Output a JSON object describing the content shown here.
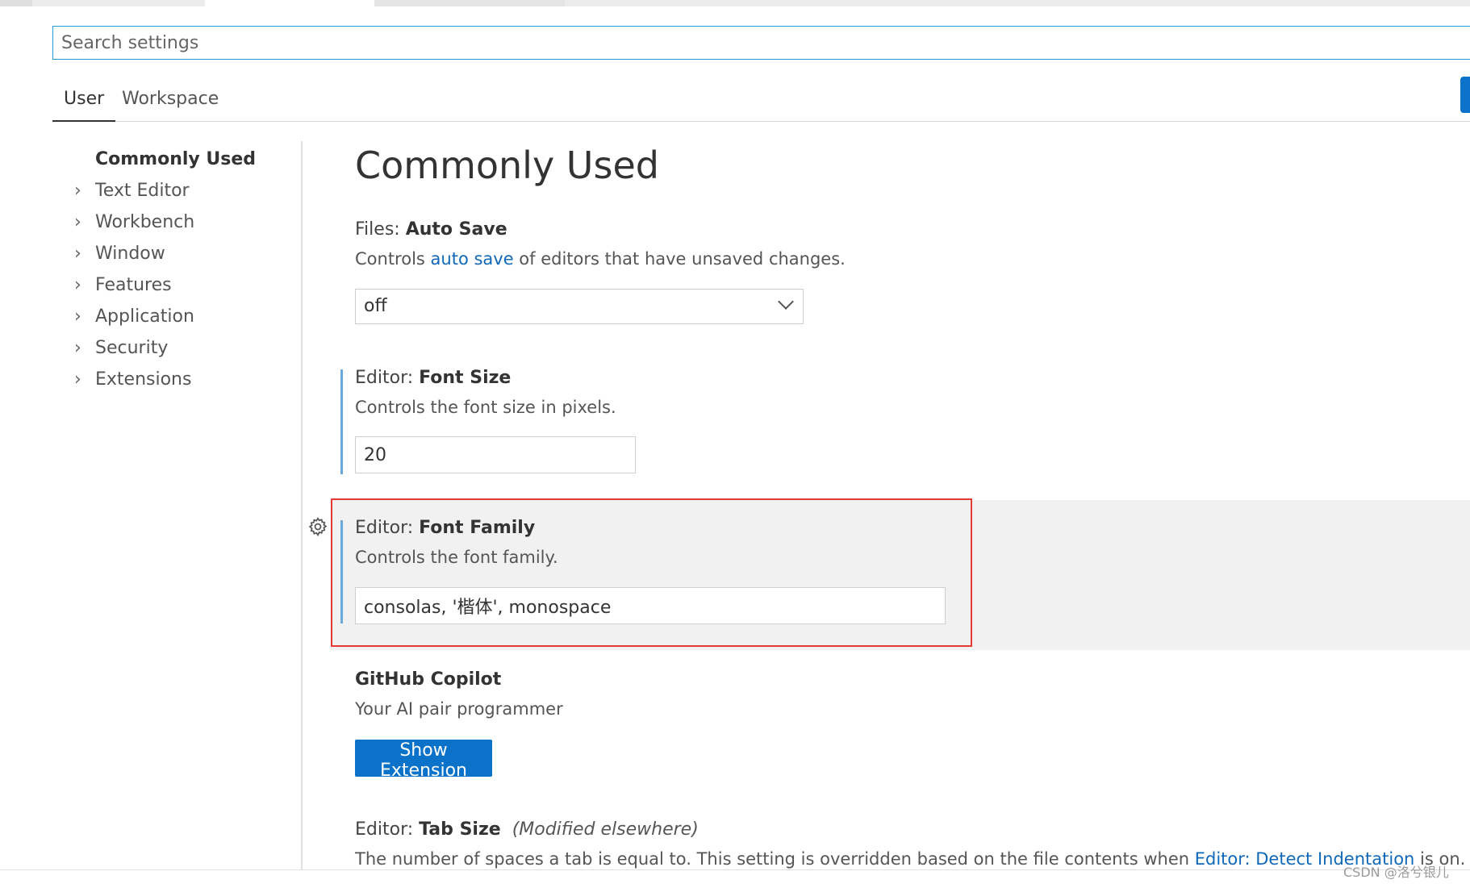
{
  "search": {
    "placeholder": "Search settings"
  },
  "tabs": [
    {
      "label": "User",
      "active": true
    },
    {
      "label": "Workspace",
      "active": false
    }
  ],
  "toc": {
    "items": [
      {
        "label": "Commonly Used",
        "bold": true,
        "chevron": false
      },
      {
        "label": "Text Editor",
        "chevron": true
      },
      {
        "label": "Workbench",
        "chevron": true
      },
      {
        "label": "Window",
        "chevron": true
      },
      {
        "label": "Features",
        "chevron": true
      },
      {
        "label": "Application",
        "chevron": true
      },
      {
        "label": "Security",
        "chevron": true
      },
      {
        "label": "Extensions",
        "chevron": true
      }
    ]
  },
  "main": {
    "title": "Commonly Used",
    "auto_save": {
      "category": "Files: ",
      "name": "Auto Save",
      "desc_before": "Controls ",
      "desc_link": "auto save",
      "desc_after": " of editors that have unsaved changes.",
      "value": "off"
    },
    "font_size": {
      "category": "Editor: ",
      "name": "Font Size",
      "desc": "Controls the font size in pixels.",
      "value": "20"
    },
    "font_family": {
      "category": "Editor: ",
      "name": "Font Family",
      "desc": "Controls the font family.",
      "value": "consolas, '楷体', monospace"
    },
    "copilot": {
      "name": "GitHub Copilot",
      "desc": "Your AI pair programmer",
      "button": "Show Extension"
    },
    "tab_size": {
      "category": "Editor: ",
      "name": "Tab Size",
      "note": "(Modified elsewhere)",
      "desc_before": "The number of spaces a tab is equal to. This setting is overridden based on the file contents when ",
      "desc_link": "Editor: Detect Indentation",
      "desc_after": " is on."
    }
  },
  "watermark": "CSDN @洛兮银儿",
  "colors": {
    "accent": "#0a72c8",
    "link": "#1068b8",
    "highlight_border": "#e53935",
    "modified_indicator": "#6aa9dc",
    "focus_background": "#f1f1f1"
  },
  "icons": [
    "chevron-right-icon",
    "chevron-down-icon",
    "gear-icon"
  ]
}
